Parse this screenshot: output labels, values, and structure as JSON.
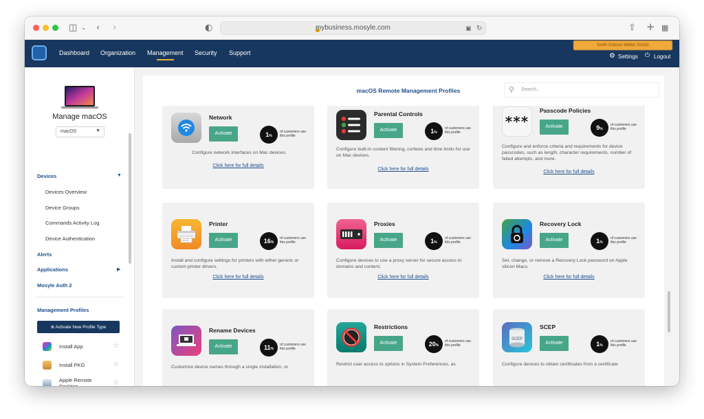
{
  "browser": {
    "url": "mybusiness.mosyle.com"
  },
  "nav": {
    "links": [
      "Dashboard",
      "Organization",
      "Management",
      "Security",
      "Support"
    ],
    "active": "Management",
    "user_badge": "Smith Dobson Walter Scholz",
    "settings_label": "Settings",
    "logout_label": "Logout"
  },
  "sidebar": {
    "title": "Manage macOS",
    "os_select": "macOS",
    "devices_heading": "Devices",
    "device_items": [
      "Devices Overview",
      "Device Groups",
      "Commands Activity Log",
      "Device Authentication"
    ],
    "alerts": "Alerts",
    "applications": "Applications",
    "auth": "Mosyle Auth 2",
    "profiles_heading": "Management Profiles",
    "activate_button": "Activate New Profile Type",
    "profile_items": [
      "Install App",
      "Install PKG",
      "Apple Remote Desktop"
    ]
  },
  "main": {
    "title": "macOS Remote Management Profiles",
    "search_placeholder": "Search...",
    "activate_label": "Activate",
    "pct_suffix": "%",
    "pct_label": "of customers use this profile",
    "link_label": "Click here for full details",
    "cards": [
      {
        "name": "Network",
        "pct": "1",
        "icon": "wifi-icon",
        "desc": "Configure network interfaces on Mac devices."
      },
      {
        "name": "Parental Controls",
        "pct": "1",
        "icon": "checklist-icon",
        "desc": "Configure built-in content filtering, curfews and time limits for use on Mac devices."
      },
      {
        "name": "Passcode Policies",
        "pct": "9",
        "icon": "asterisk-password-icon",
        "desc": "Configure and enforce criteria and requirements for device passcodes, such as length, character requirements, number of failed attempts, and more."
      },
      {
        "name": "Printer",
        "pct": "16",
        "icon": "printer-icon",
        "desc": "Install and configure settings for printers with either generic or custom printer drivers."
      },
      {
        "name": "Proxies",
        "pct": "1",
        "icon": "server-icon",
        "desc": "Configure devices to use a proxy server for secure access to domains and content."
      },
      {
        "name": "Recovery Lock",
        "pct": "1",
        "icon": "padlock-icon",
        "desc": "Set, change, or remove a Recovery Lock password on Apple silicon Macs."
      },
      {
        "name": "Rename Devices",
        "pct": "11",
        "icon": "laptop-rename-icon",
        "desc": "Customize device names through a single installation, or"
      },
      {
        "name": "Restrictions",
        "pct": "20",
        "icon": "no-entry-icon",
        "desc": "Restrict user access to options in System Preferences, as"
      },
      {
        "name": "SCEP",
        "pct": "1",
        "icon": "certificate-jar-icon",
        "desc": "Configure devices to obtain certificates from a certificate"
      }
    ]
  },
  "colors": {
    "nav_bg": "#17375e",
    "accent_green": "#48a688",
    "link_blue": "#1d4e8c",
    "badge_orange": "#f2a93b"
  }
}
